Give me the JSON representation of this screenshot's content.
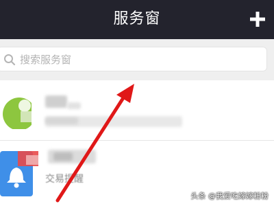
{
  "header": {
    "title": "服务窗",
    "add_icon": "plus-icon",
    "background_color": "#23232d"
  },
  "search": {
    "placeholder": "搜索服务窗",
    "icon": "search-icon"
  },
  "list": {
    "items": [
      {
        "icon": "green-avatar-icon"
      },
      {
        "icon": "bell-icon",
        "label": "交易提醒"
      }
    ]
  },
  "watermark": {
    "text": "头条 @我爱吃嫁嫁粉粉"
  },
  "colors": {
    "accent_green": "#8dc63f",
    "accent_blue": "#3f8fe8",
    "arrow_red": "#e01818"
  }
}
